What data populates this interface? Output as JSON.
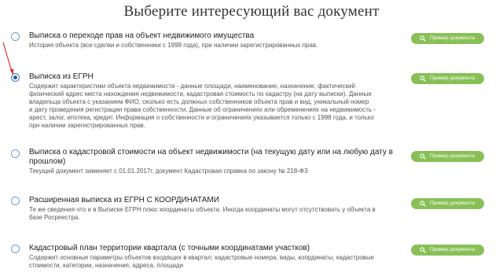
{
  "page_title": "Выберите интересующий вас документ",
  "button_label": "Пример документа",
  "colors": {
    "button": "#88c057",
    "radio": "#1e5aa8",
    "arrow": "#e0302a"
  },
  "options": [
    {
      "title": "Выписка о переходе прав на объект недвижимого имущества",
      "description": [
        "История объекта (все сделки и собственники с 1998 года), при наличии зарегистрированных прав."
      ],
      "selected": false
    },
    {
      "title": "Выписка из ЕГРН",
      "description": [
        "Содержит характеристики объекта недвижимости - данные площади, наименование, назначение, фактический",
        "физический адрес места нахождения недвижимости, кадастровая стоимость по кадастру (на дату выписки). Данные",
        "владельца объекта с указанием ФИО, сколько есть должных собственников объекта прав и вид, уникальный номер",
        "и дату проведения регистрации права собственности. Данные об ограничениях или обременениях на недвижимость -",
        "арест, залог, ипотека, кредит. Информация о собственности и ограничениях указывается только с 1998 года, и только",
        "при наличии зарегистрированных прав."
      ],
      "selected": true
    },
    {
      "title_lines": [
        "Выписка о кадастровой стоимости на объект недвижимости (на текущую дату или на любую дату в",
        "прошлом)"
      ],
      "description": [
        "Текущий документ заменяет с 01.01.2017г. документ Кадастровая справка по закону № 218-ФЗ"
      ],
      "selected": false
    },
    {
      "title": "Расширенная выписка из ЕГРН С КООРДИНАТАМИ",
      "description": [
        "Те же сведения что и в Выписке ЕГРН плюс координаты объекта. Иногда координаты могут отсутствовать у объекта в",
        "базе Росреестра."
      ],
      "selected": false
    },
    {
      "title": "Кадастровый план территории квартала (с точными координатами участков)",
      "description": [
        "Содержит основные параметры объектов входящих в квартал: кадастровые номера, виды, координаты, кадастровые",
        "стоимости, категории, назначения, адреса, площади"
      ],
      "selected": false
    }
  ]
}
